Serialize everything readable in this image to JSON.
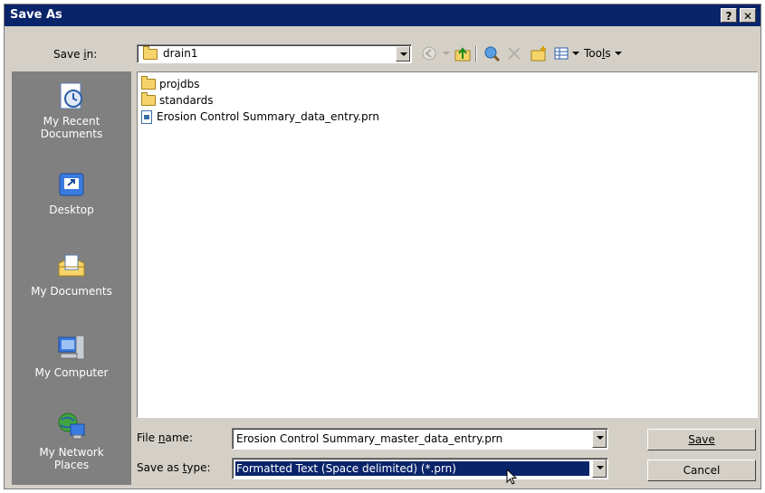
{
  "titlebar": {
    "title": "Save As",
    "help": "?",
    "close": "✕"
  },
  "location": {
    "label": "Save in:",
    "label_accel": "i",
    "value": "drain1"
  },
  "toolbar": {
    "tools_label": "Tools"
  },
  "places": [
    {
      "name": "My Recent Documents",
      "icon": "recent-documents-icon"
    },
    {
      "name": "Desktop",
      "icon": "desktop-icon"
    },
    {
      "name": "My Documents",
      "icon": "my-documents-icon"
    },
    {
      "name": "My Computer",
      "icon": "my-computer-icon"
    },
    {
      "name": "My Network Places",
      "icon": "network-places-icon"
    }
  ],
  "files": [
    {
      "name": "projdbs",
      "type": "folder"
    },
    {
      "name": "standards",
      "type": "folder"
    },
    {
      "name": "Erosion Control Summary_data_entry.prn",
      "type": "file"
    }
  ],
  "filename": {
    "label": "File name:",
    "value": "Erosion Control Summary_master_data_entry.prn"
  },
  "filetype": {
    "label": "Save as type:",
    "value": "Formatted Text (Space delimited) (*.prn)"
  },
  "buttons": {
    "save": "Save",
    "cancel": "Cancel"
  },
  "colors": {
    "titlebar": "#0a246a",
    "dialog": "#d4d0c8",
    "selection": "#0a246a",
    "places_bar": "#808080"
  }
}
